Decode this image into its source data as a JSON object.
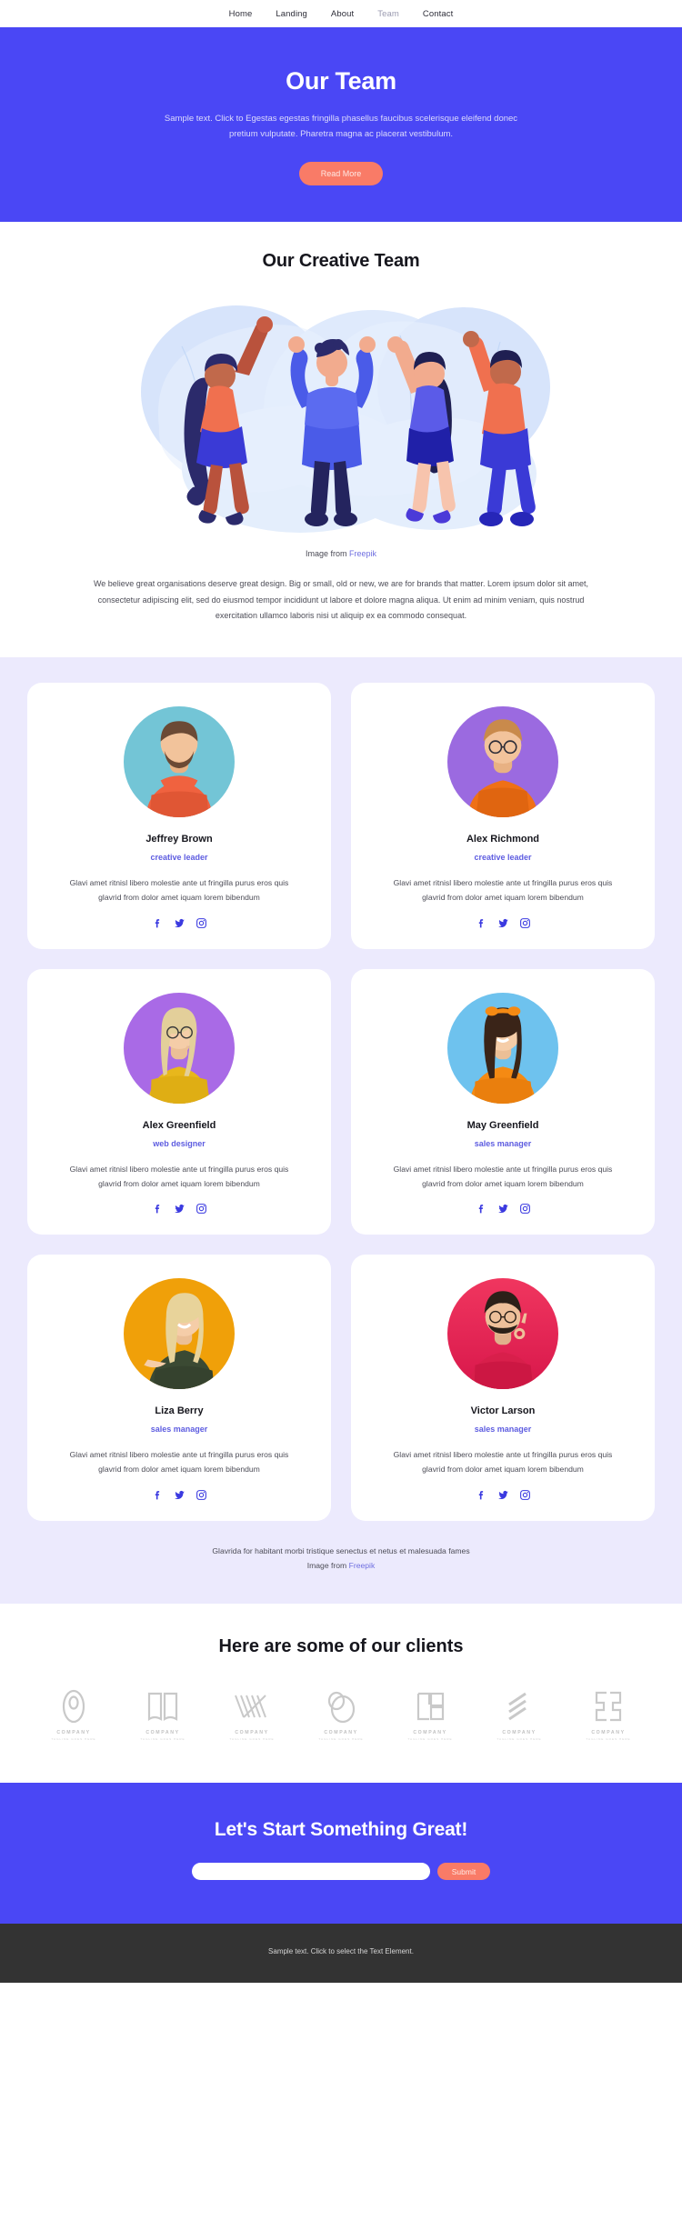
{
  "nav": {
    "items": [
      {
        "label": "Home",
        "active": false
      },
      {
        "label": "Landing",
        "active": false
      },
      {
        "label": "About",
        "active": false
      },
      {
        "label": "Team",
        "active": true
      },
      {
        "label": "Contact",
        "active": false
      }
    ]
  },
  "hero": {
    "title": "Our Team",
    "subtitle": "Sample text. Click to Egestas egestas fringilla phasellus faucibus scelerisque eleifend donec pretium vulputate. Pharetra magna ac placerat vestibulum.",
    "button_label": "Read More"
  },
  "creative": {
    "title": "Our Creative Team",
    "image_caption_prefix": "Image from ",
    "image_caption_link": "Freepik",
    "paragraph": "We believe great organisations deserve great design. Big or small, old or new, we are for brands that matter. Lorem ipsum dolor sit amet, consectetur adipiscing elit, sed do eiusmod tempor incididunt ut labore et dolore magna aliqua. Ut enim ad minim veniam, quis nostrud exercitation ullamco laboris nisi ut aliquip ex ea commodo consequat."
  },
  "team": {
    "members": [
      {
        "name": "Jeffrey Brown",
        "role": "creative leader",
        "description": "Glavi amet ritnisl libero molestie ante ut fringilla purus eros quis glavrid from dolor amet iquam lorem bibendum",
        "avatar_bg": "#73c5d6",
        "shirt": "#f0623f",
        "skin": "#f2c39b",
        "hair": "#6b4a35",
        "socials": [
          "facebook-icon",
          "twitter-icon",
          "instagram-icon"
        ]
      },
      {
        "name": "Alex Richmond",
        "role": "creative leader",
        "description": "Glavi amet ritnisl libero molestie ante ut fringilla purus eros quis glavrid from dolor amet iquam lorem bibendum",
        "avatar_bg": "#9b6ae0",
        "shirt": "#ef7016",
        "skin": "#f2c39b",
        "hair": "#c98a4b",
        "socials": [
          "facebook-icon",
          "twitter-icon",
          "instagram-icon"
        ]
      },
      {
        "name": "Alex Greenfield",
        "role": "web designer",
        "description": "Glavi amet ritnisl libero molestie ante ut fringilla purus eros quis glavrid from dolor amet iquam lorem bibendum",
        "avatar_bg": "#a96ae6",
        "shirt": "#e8b71c",
        "skin": "#f5cda8",
        "hair": "#e3cf9a",
        "socials": [
          "facebook-icon",
          "twitter-icon",
          "instagram-icon"
        ]
      },
      {
        "name": "May Greenfield",
        "role": "sales manager",
        "description": "Glavi amet ritnisl libero molestie ante ut fringilla purus eros quis glavrid from dolor amet iquam lorem bibendum",
        "avatar_bg": "#6ec2ee",
        "shirt": "#f58a13",
        "skin": "#f5cda8",
        "hair": "#3a2418",
        "socials": [
          "facebook-icon",
          "twitter-icon",
          "instagram-icon"
        ]
      },
      {
        "name": "Liza Berry",
        "role": "sales manager",
        "description": "Glavi amet ritnisl libero molestie ante ut fringilla purus eros quis glavrid from dolor amet iquam lorem bibendum",
        "avatar_bg": "#f0a009",
        "shirt": "#3b4a33",
        "skin": "#f5cda8",
        "hair": "#e8d39a",
        "socials": [
          "facebook-icon",
          "twitter-icon",
          "instagram-icon"
        ]
      },
      {
        "name": "Victor Larson",
        "role": "sales manager",
        "description": "Glavi amet ritnisl libero molestie ante ut fringilla purus eros quis glavrid from dolor amet iquam lorem bibendum",
        "avatar_bg": "#e8295b",
        "shirt": "#d81f4b",
        "skin": "#eec09a",
        "hair": "#2b2018",
        "socials": [
          "facebook-icon",
          "twitter-icon",
          "instagram-icon"
        ]
      }
    ],
    "footnote_line1": "Glavrida for habitant morbi tristique senectus et netus et malesuada fames",
    "footnote_prefix": "Image from ",
    "footnote_link": "Freepik"
  },
  "clients": {
    "title": "Here are some of our clients",
    "logos": [
      {
        "name": "COMPANY",
        "tagline": "TAGLINE GOES HERE",
        "icon": "logo-oval-mark"
      },
      {
        "name": "COMPANY",
        "tagline": "TAGLINE GOES HERE",
        "icon": "logo-book-mark"
      },
      {
        "name": "COMPANY",
        "tagline": "TAGLINE GOES HERE",
        "icon": "logo-chevron-mark"
      },
      {
        "name": "COMPANY",
        "tagline": "TAGLINE GOES HERE",
        "icon": "logo-circles-mark"
      },
      {
        "name": "COMPANY",
        "tagline": "TAGLINE GOES HERE",
        "icon": "logo-squares-mark"
      },
      {
        "name": "COMPANY",
        "tagline": "TAGLINE GOES HERE",
        "icon": "logo-slashes-mark"
      },
      {
        "name": "COMPANY",
        "tagline": "TAGLINE GOES HERE",
        "icon": "logo-bracket-mark"
      }
    ]
  },
  "cta": {
    "title": "Let's Start Something Great!",
    "input_placeholder": "",
    "input_value": "",
    "submit_label": "Submit"
  },
  "footer": {
    "text": "Sample text. Click to select the Text Element."
  },
  "colors": {
    "brand_blue": "#4a47f5",
    "coral": "#f97b67",
    "lavender_bg": "#eceafd",
    "role_blue": "#5d5ce0",
    "footer_dark": "#333333"
  }
}
